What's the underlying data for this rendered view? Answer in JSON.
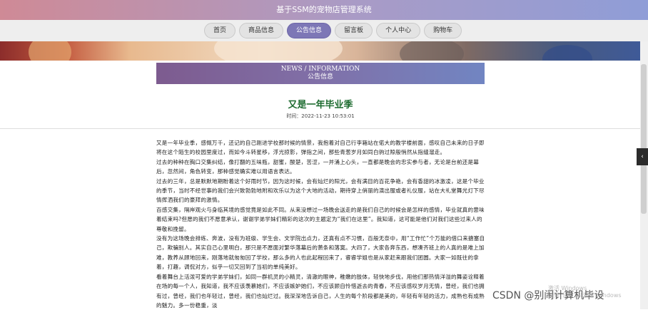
{
  "app": {
    "title": "基于SSM的宠物店管理系统"
  },
  "nav": {
    "items": [
      {
        "label": "首页",
        "active": false
      },
      {
        "label": "商品信息",
        "active": false
      },
      {
        "label": "公告信息",
        "active": true
      },
      {
        "label": "留言板",
        "active": false
      },
      {
        "label": "个人中心",
        "active": false
      },
      {
        "label": "购物车",
        "active": false
      }
    ]
  },
  "section": {
    "en": "NEWS / INFORMATION",
    "zh": "公告信息"
  },
  "article": {
    "title": "又是一年毕业季",
    "time": "时间：2022-11-23 10:53:01",
    "paragraphs": [
      "又是一年毕业季，感慨万千，还记的自己刚进学校那时候的情景，我抱着对自己行李箱站在偌大的教学楼前面，感叹自己未来的日子即将在这个陌生的校园里度过，而如今斗转星移，浮光掠影，弹指之间，那些青葱岁月如同白驹过隙般悄然从指缝溜走。",
      "过去的种种在胸口交集纠结，像打翻的五味瓶，甜蜜，酸楚，苦涩，一并涌上心头，一直都是晚会的忠实参与者，无论是台前还是幕后，忽然间，角色转变，那种感觉确实难以用语言表达。",
      "过去的三年，总是默默地期盼着这个好雨时节，因为这时候，会有灿烂的阳光，会有满目的百花争艳，会有香甜的冰激凌，这是个毕业的季节，当时不经世事的我们会兴致勃勃地附和欢乐以为这个大地的活动，期待穿上俏丽的演出服或者礼仪服，站在大礼堂舞光灯下尽情挥洒我们的豪拜的激情。",
      "百感交集，隔岸观火与身临其境的感觉竟是如此不同。从来没想过一场晚会送走的是我们自己的时候会是怎样的感情，毕业就真的意味着结束吗?但愿的我们不愿意承认，谢谢学弟学妹们精彩的这次的主题定为“我们在这里”。我知道，这可能是他们对我们这些过来人的尊敬和挽留。",
      "没有为这场晚会排练、奔波，没有为班级、学生会、文学院出点力，还真有点不习惯，百般无奈中，用“工作忙”个万能的借口来搪塞自己，欺骗别人。其实自己心里明白，那只是不愿面对繁华落幕后的萧条和落寞。大四了，大家各奔东西，想凑齐班上的人真的是难上加难，教养从顾地回来，刚落地就匆匆回了学校，那么多的人也此起程回来了，睿睿学姐也是从家赶来跟我们团圆。大家一如既往的拿着，打趣，调侃对方，似乎一切又回到了当初的单纯美好。",
      "看着舞台上活泼可爱的学弟学妹们，如同一群机灵的小精灵，清澈的眼神，稚嫩的肢体，轻快地步伐，用他们那热情洋溢的舞姿诠释着在场的每一个人，我知道，我不应该羡慕她们，不应该嫉妒她们，不应该顾自怜惜逝去的青春，不应该感叹岁月无情，曾经，我们也拥有过，曾经，我们也年轻过，曾经，我们也灿烂过。我深深地告诉自己，人生的每个阶段都是美的，年轻有年轻的活力，成熟也有成熟的魅力。多一份稳重，淡"
    ]
  },
  "overlay": {
    "activation_line1": "激活 Windows",
    "activation_line2": "转到“设置”以激活 Windows",
    "csdn": "CSDN @别闹计算机毕设"
  },
  "colors": {
    "topbar_start": "#cf8a96",
    "topbar_end": "#8f9dd7",
    "nav_active": "#7d77b6",
    "article_title": "#1d6b2f"
  }
}
